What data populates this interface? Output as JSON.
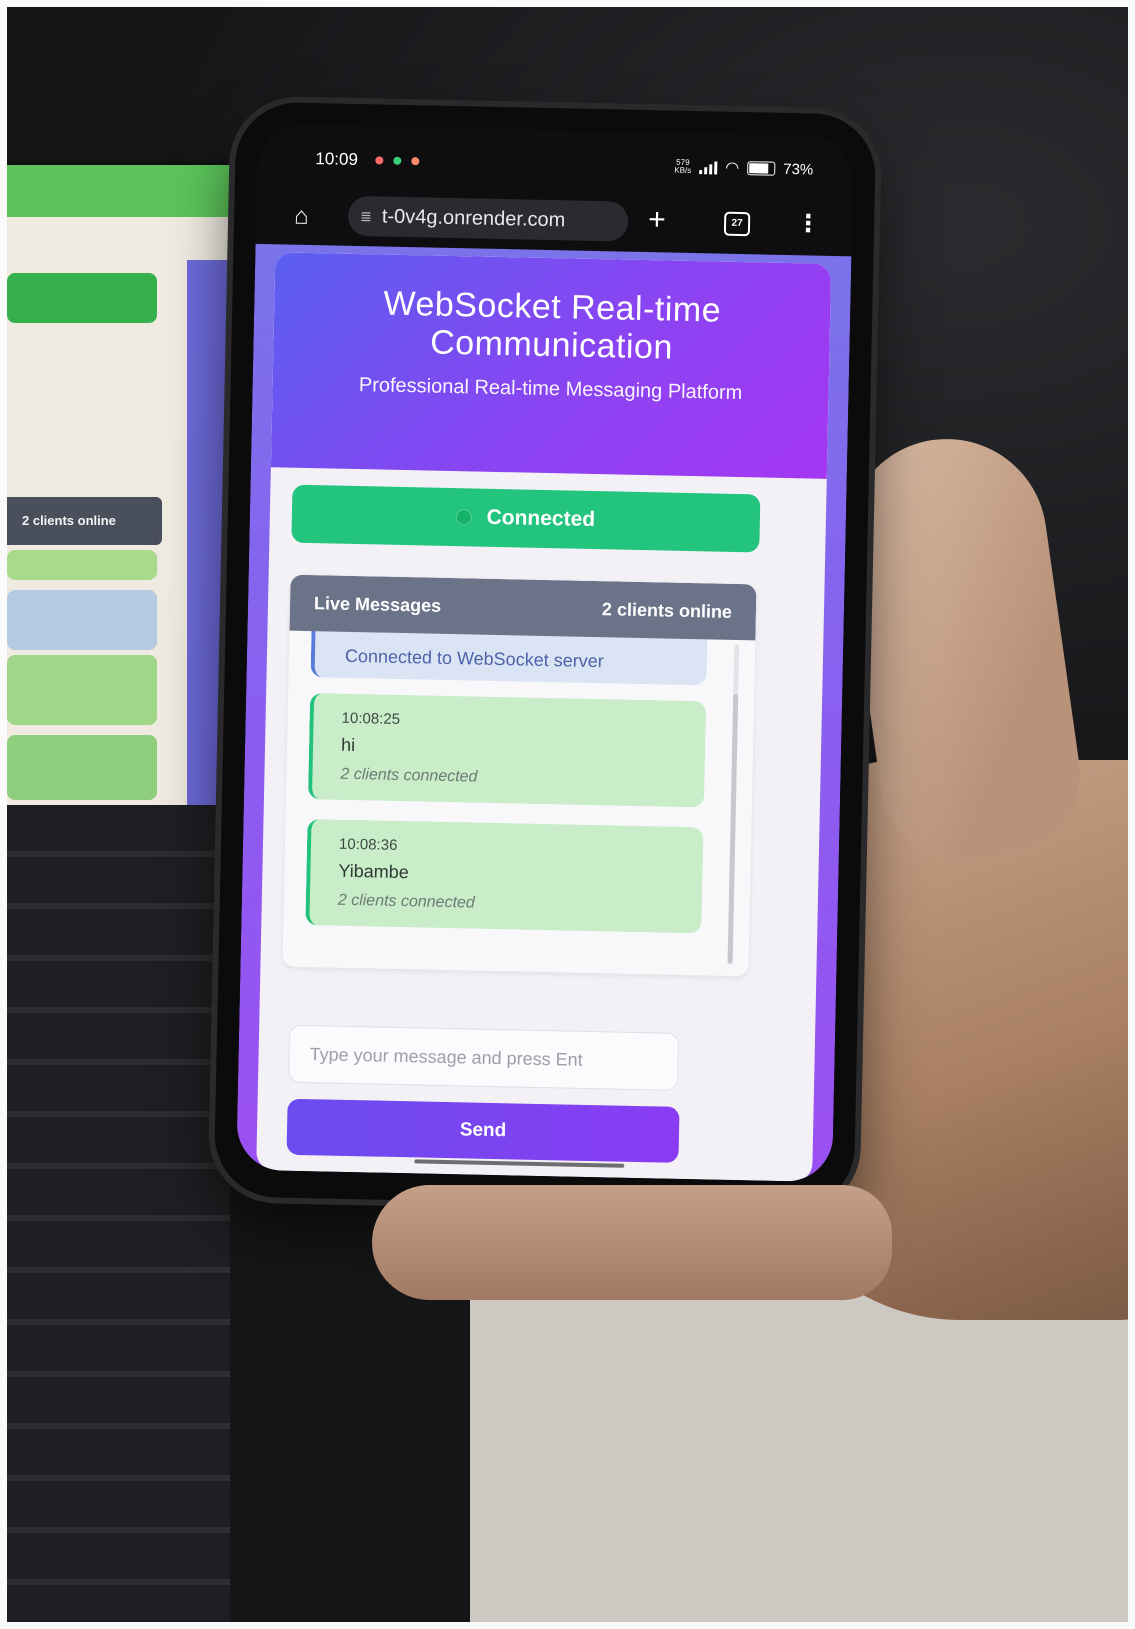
{
  "laptop": {
    "clients_chip": "2 clients online"
  },
  "statusbar": {
    "time": "10:09",
    "net_speed": "579\nKB/s",
    "battery": "73%"
  },
  "browser": {
    "url": "t-0v4g.onrender.com",
    "tab_count": "27"
  },
  "app": {
    "title": "WebSocket Real-time Communication",
    "subtitle": "Professional Real-time Messaging Platform",
    "connection_status": "Connected",
    "messages_header": "Live Messages",
    "clients_online": "2 clients online",
    "system_message": "Connected to WebSocket server",
    "messages": [
      {
        "time": "10:08:25",
        "text": "hi",
        "meta": "2 clients connected"
      },
      {
        "time": "10:08:36",
        "text": "Yibambe",
        "meta": "2 clients connected"
      }
    ],
    "input_placeholder": "Type your message and press Ent",
    "send_label": "Send"
  },
  "colors": {
    "header_gradient_start": "#5a5ff0",
    "header_gradient_end": "#a437f2",
    "connected_green": "#22c47e",
    "message_bg": "#c9ecc9",
    "panel_header": "#6b7388"
  },
  "icons": [
    "home-icon",
    "site-settings-icon",
    "new-tab-icon",
    "tab-switcher-icon",
    "menu-icon",
    "wifi-icon",
    "battery-icon",
    "signal-icon"
  ]
}
